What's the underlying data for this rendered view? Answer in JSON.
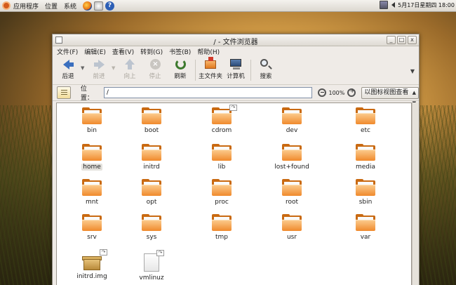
{
  "panel": {
    "menus": [
      "应用程序",
      "位置",
      "系统"
    ],
    "clock": "5月17日星期四 18:00"
  },
  "window": {
    "title": "/ - 文件浏览器",
    "min_label": "_",
    "max_label": "□",
    "close_label": "x"
  },
  "menubar": [
    "文件(F)",
    "编辑(E)",
    "查看(V)",
    "转到(G)",
    "书签(B)",
    "帮助(H)"
  ],
  "toolbar": {
    "back": "后退",
    "forward": "前进",
    "up": "向上",
    "stop": "停止",
    "reload": "刷新",
    "home": "主文件夹",
    "computer": "计算机",
    "search": "搜索"
  },
  "location": {
    "label": "位置：",
    "value": "/",
    "zoom": "100%",
    "view_mode": "以图标视图查看"
  },
  "files": [
    {
      "name": "bin",
      "type": "folder"
    },
    {
      "name": "boot",
      "type": "folder"
    },
    {
      "name": "cdrom",
      "type": "folder-link"
    },
    {
      "name": "dev",
      "type": "folder"
    },
    {
      "name": "etc",
      "type": "folder"
    },
    {
      "name": "home",
      "type": "folder",
      "selected": true
    },
    {
      "name": "initrd",
      "type": "folder"
    },
    {
      "name": "lib",
      "type": "folder"
    },
    {
      "name": "lost+found",
      "type": "folder"
    },
    {
      "name": "media",
      "type": "folder"
    },
    {
      "name": "mnt",
      "type": "folder"
    },
    {
      "name": "opt",
      "type": "folder"
    },
    {
      "name": "proc",
      "type": "folder"
    },
    {
      "name": "root",
      "type": "folder"
    },
    {
      "name": "sbin",
      "type": "folder"
    },
    {
      "name": "srv",
      "type": "folder"
    },
    {
      "name": "sys",
      "type": "folder"
    },
    {
      "name": "tmp",
      "type": "folder"
    },
    {
      "name": "usr",
      "type": "folder"
    },
    {
      "name": "var",
      "type": "folder"
    },
    {
      "name": "initrd.img",
      "type": "package-link"
    },
    {
      "name": "vmlinuz",
      "type": "file-link"
    }
  ]
}
